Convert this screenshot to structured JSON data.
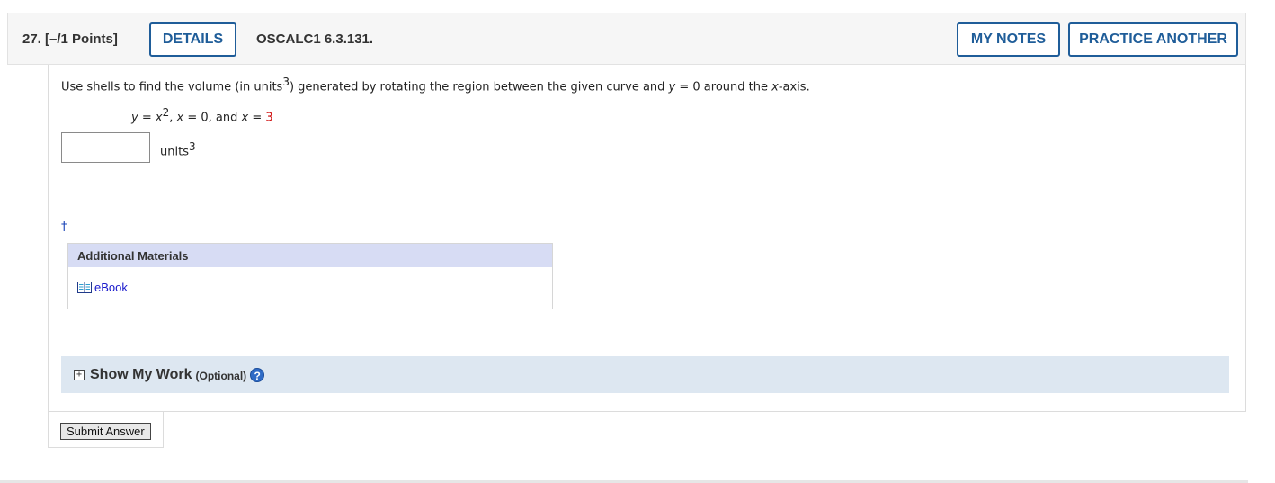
{
  "header": {
    "question_number": "27.",
    "points": "[–/1 Points]",
    "details_label": "DETAILS",
    "question_id": "OSCALC1 6.3.131.",
    "my_notes_label": "MY NOTES",
    "practice_another_label": "PRACTICE ANOTHER"
  },
  "question": {
    "prompt_part1": "Use shells to find the volume (in units",
    "prompt_sup": "3",
    "prompt_part2": ") generated by rotating the region between the given curve and ",
    "prompt_y": "y",
    "prompt_part3": " = 0 around the ",
    "prompt_x": "x",
    "prompt_part4": "-axis.",
    "math_y": "y",
    "math_eq1": " = ",
    "math_x1": "x",
    "math_exp": "2",
    "math_sep1": ", ",
    "math_x2": "x",
    "math_eq2": " = 0, and ",
    "math_x3": "x",
    "math_eq3": " = ",
    "math_val": "3",
    "answer_value": "",
    "units_label": "units",
    "units_sup": "3",
    "dagger": "†"
  },
  "materials": {
    "heading": "Additional Materials",
    "ebook_label": "eBook",
    "ebook_icon": "book-icon"
  },
  "show_work": {
    "expand_symbol": "+",
    "title": "Show My Work",
    "optional": "(Optional)",
    "help_symbol": "?"
  },
  "submit": {
    "label": "Submit Answer"
  },
  "colors": {
    "accent": "#1f5d99",
    "highlight_value": "#d01414",
    "materials_header": "#d7dcf4",
    "show_work_bg": "#dde7f1"
  }
}
